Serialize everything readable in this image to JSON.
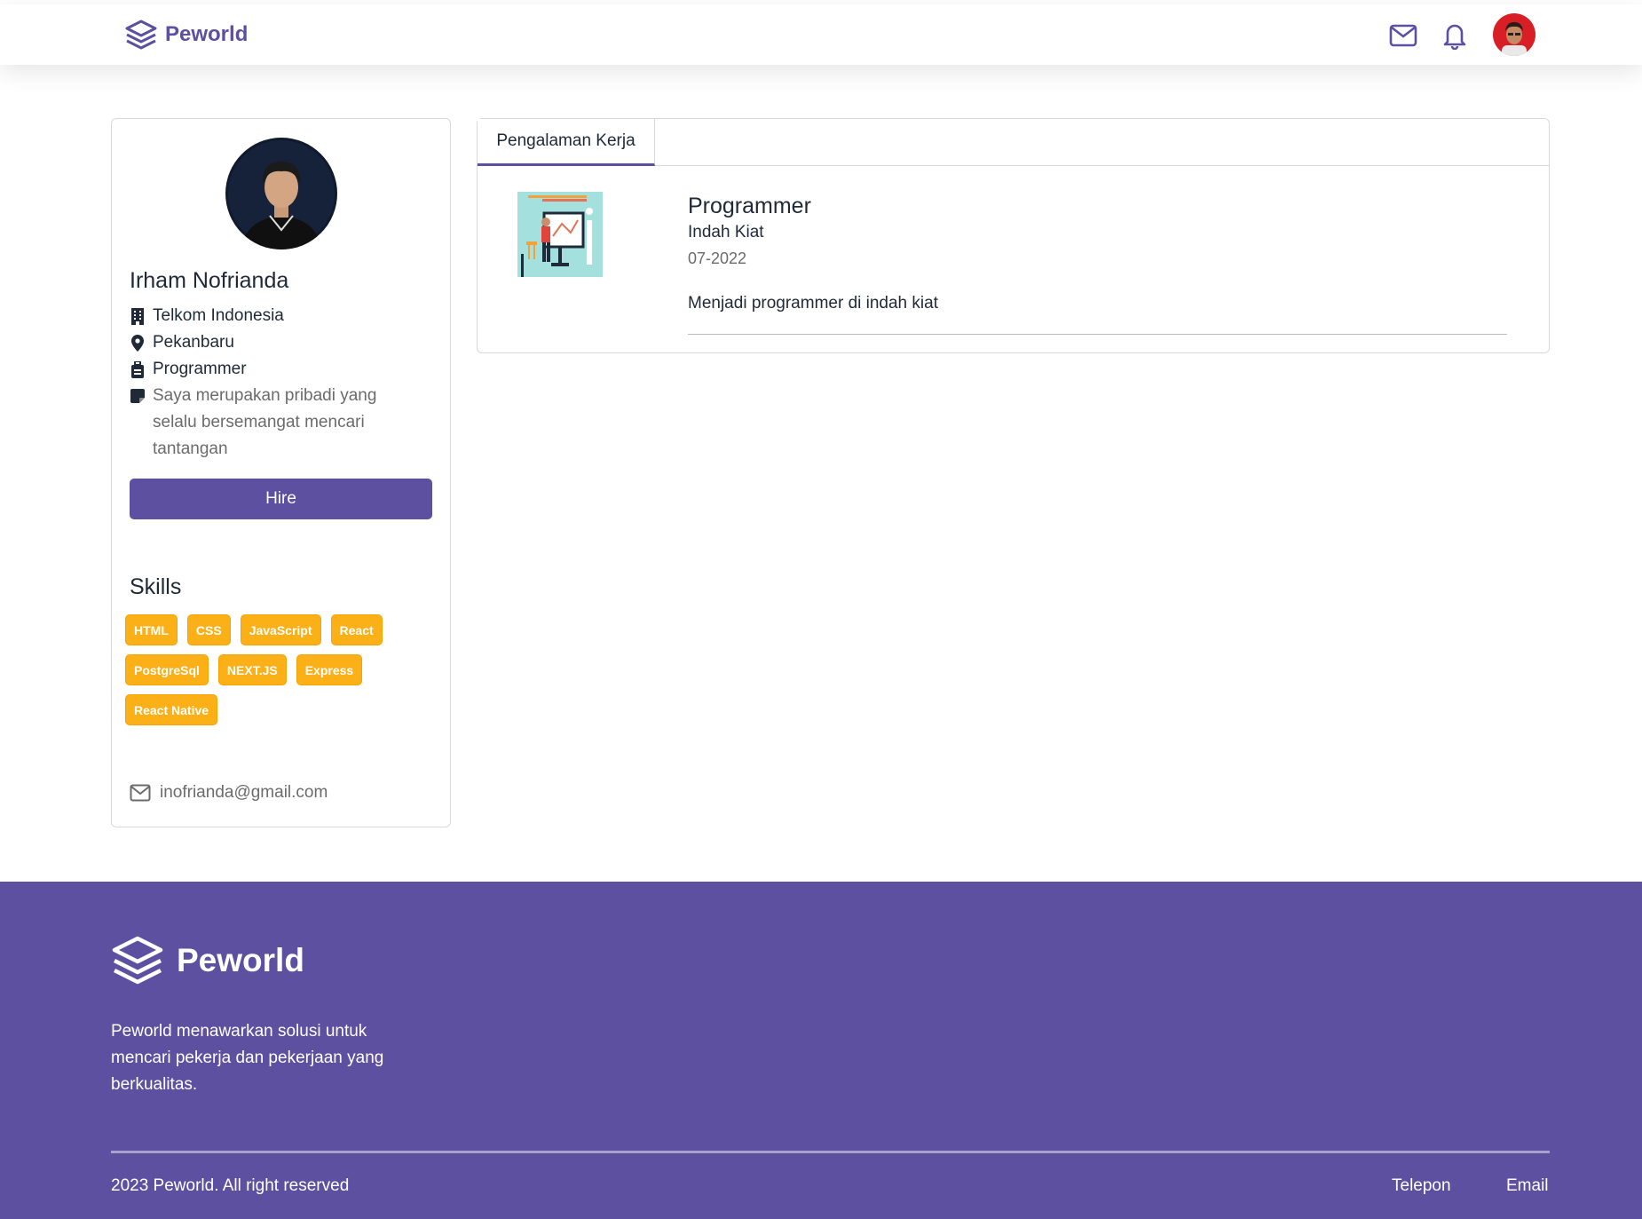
{
  "navbar": {
    "brand": "Peworld",
    "icons": [
      "mail-icon",
      "bell-icon"
    ],
    "accent": "#5e50a1"
  },
  "profile": {
    "name": "Irham Nofrianda",
    "company": "Telkom Indonesia",
    "location": "Pekanbaru",
    "job": "Programmer",
    "bio": "Saya merupakan pribadi yang selalu bersemangat mencari tantangan",
    "hire_label": "Hire",
    "skills_title": "Skills",
    "skills": [
      "HTML",
      "CSS",
      "JavaScript",
      "React",
      "PostgreSql",
      "NEXT.JS",
      "Express",
      "React Native"
    ],
    "email": "inofrianda@gmail.com",
    "skill_color": "#fbb017"
  },
  "experience": {
    "tab_label": "Pengalaman Kerja",
    "items": [
      {
        "position": "Programmer",
        "company": "Indah Kiat",
        "date": "07-2022",
        "description": "Menjadi programmer di indah kiat"
      }
    ]
  },
  "footer": {
    "brand": "Peworld",
    "description": "Peworld menawarkan solusi untuk mencari pekerja dan pekerjaan yang berkualitas.",
    "copyright": "2023 Peworld. All right reserved",
    "links": [
      "Telepon",
      "Email"
    ]
  }
}
